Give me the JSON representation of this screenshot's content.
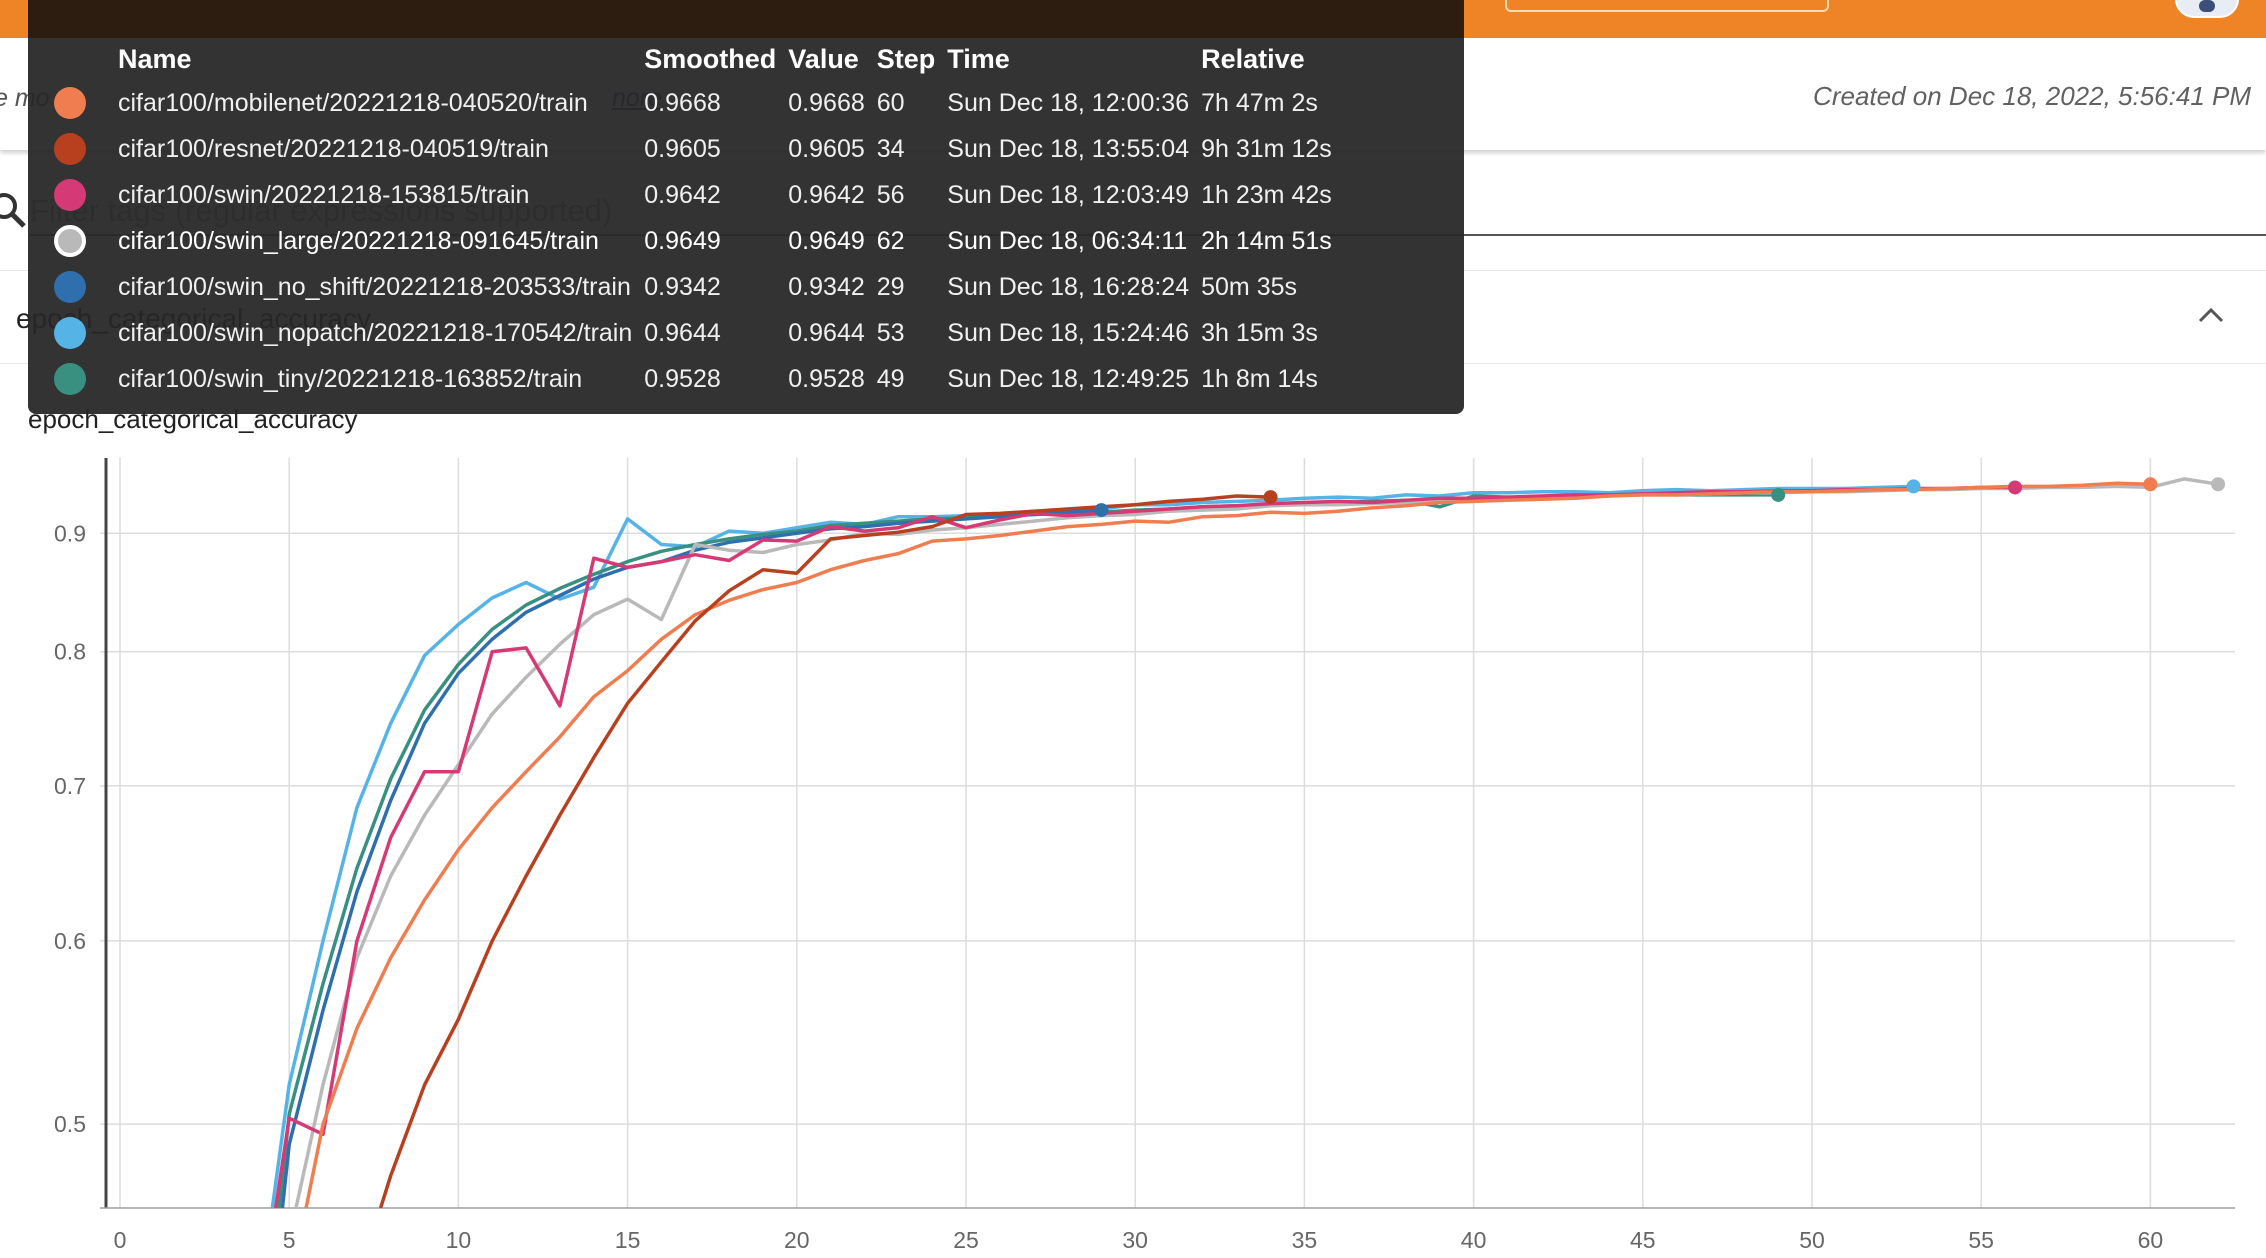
{
  "header": {
    "description_left": "e mo",
    "description_link": "nore",
    "created": "Created on Dec 18, 2022, 5:56:41 PM"
  },
  "filter": {
    "placeholder": "Filter tags (regular expressions supported)"
  },
  "card": {
    "title": "epoch_categorical_accuracy"
  },
  "colors": {
    "mobilenet": "#ef7d4f",
    "resnet": "#b8401f",
    "swin": "#d63a76",
    "swin_large": "#b9b9b9",
    "swin_no_shift": "#2f6fae",
    "swin_nopatch": "#55b3e6",
    "swin_tiny": "#3a9080"
  },
  "tooltip": {
    "columns": [
      "Name",
      "Smoothed",
      "Value",
      "Step",
      "Time",
      "Relative"
    ],
    "rows": [
      {
        "key": "mobilenet",
        "name": "cifar100/mobilenet/20221218-040520/train",
        "smoothed": "0.9668",
        "value": "0.9668",
        "step": "60",
        "time": "Sun Dec 18, 12:00:36",
        "relative": "7h 47m 2s"
      },
      {
        "key": "resnet",
        "name": "cifar100/resnet/20221218-040519/train",
        "smoothed": "0.9605",
        "value": "0.9605",
        "step": "34",
        "time": "Sun Dec 18, 13:55:04",
        "relative": "9h 31m 12s"
      },
      {
        "key": "swin",
        "name": "cifar100/swin/20221218-153815/train",
        "smoothed": "0.9642",
        "value": "0.9642",
        "step": "56",
        "time": "Sun Dec 18, 12:03:49",
        "relative": "1h 23m 42s"
      },
      {
        "key": "swin_large",
        "name": "cifar100/swin_large/20221218-091645/train",
        "smoothed": "0.9649",
        "value": "0.9649",
        "step": "62",
        "time": "Sun Dec 18, 06:34:11",
        "relative": "2h 14m 51s",
        "highlighted": true
      },
      {
        "key": "swin_no_shift",
        "name": "cifar100/swin_no_shift/20221218-203533/train",
        "smoothed": "0.9342",
        "value": "0.9342",
        "step": "29",
        "time": "Sun Dec 18, 16:28:24",
        "relative": "50m 35s"
      },
      {
        "key": "swin_nopatch",
        "name": "cifar100/swin_nopatch/20221218-170542/train",
        "smoothed": "0.9644",
        "value": "0.9644",
        "step": "53",
        "time": "Sun Dec 18, 15:24:46",
        "relative": "3h 15m 3s"
      },
      {
        "key": "swin_tiny",
        "name": "cifar100/swin_tiny/20221218-163852/train",
        "smoothed": "0.9528",
        "value": "0.9528",
        "step": "49",
        "time": "Sun Dec 18, 12:49:25",
        "relative": "1h 8m 14s"
      }
    ]
  },
  "chart_data": {
    "type": "line",
    "title": "epoch_categorical_accuracy",
    "xlim": [
      0,
      62.5
    ],
    "ylim": [
      0.46,
      0.97
    ],
    "y_scale": "log",
    "x_ticks": [
      0,
      5,
      10,
      15,
      20,
      25,
      30,
      35,
      40,
      45,
      50,
      55,
      60
    ],
    "y_ticks": [
      0.5,
      0.6,
      0.7,
      0.8,
      0.9
    ],
    "grid": true,
    "series": [
      {
        "key": "swin_nopatch",
        "x": [
          4.5,
          5,
          6,
          7,
          8,
          9,
          10,
          11,
          12,
          13,
          14,
          15,
          16,
          17,
          18,
          19,
          20,
          21,
          22,
          23,
          24,
          25,
          26,
          27,
          28,
          29,
          30,
          31,
          32,
          33,
          34,
          35,
          36,
          37,
          38,
          39,
          40,
          41,
          42,
          43,
          44,
          45,
          46,
          47,
          48,
          49,
          50,
          51,
          52,
          53
        ],
        "y": [
          0.46,
          0.52,
          0.6,
          0.685,
          0.745,
          0.797,
          0.822,
          0.844,
          0.857,
          0.843,
          0.853,
          0.913,
          0.89,
          0.888,
          0.902,
          0.9,
          0.905,
          0.91,
          0.908,
          0.915,
          0.915,
          0.916,
          0.917,
          0.92,
          0.919,
          0.922,
          0.926,
          0.926,
          0.928,
          0.929,
          0.93,
          0.932,
          0.933,
          0.932,
          0.935,
          0.934,
          0.937,
          0.937,
          0.938,
          0.938,
          0.937,
          0.939,
          0.94,
          0.939,
          0.94,
          0.941,
          0.941,
          0.941,
          0.942,
          0.943
        ]
      },
      {
        "key": "swin_tiny",
        "x": [
          4.7,
          5,
          6,
          7,
          8,
          9,
          10,
          11,
          12,
          13,
          14,
          15,
          16,
          17,
          18,
          19,
          20,
          21,
          22,
          23,
          24,
          25,
          26,
          27,
          28,
          29,
          30,
          31,
          32,
          33,
          34,
          35,
          36,
          37,
          38,
          39,
          40,
          41,
          42,
          43,
          44,
          45,
          46,
          47,
          48,
          49
        ],
        "y": [
          0.46,
          0.505,
          0.575,
          0.645,
          0.705,
          0.755,
          0.79,
          0.818,
          0.838,
          0.852,
          0.864,
          0.875,
          0.884,
          0.89,
          0.895,
          0.899,
          0.902,
          0.907,
          0.909,
          0.911,
          0.913,
          0.914,
          0.916,
          0.917,
          0.918,
          0.919,
          0.921,
          0.922,
          0.924,
          0.925,
          0.926,
          0.927,
          0.928,
          0.929,
          0.93,
          0.924,
          0.934,
          0.933,
          0.932,
          0.934,
          0.935,
          0.936,
          0.935,
          0.935,
          0.935,
          0.935
        ]
      },
      {
        "key": "swin_no_shift",
        "x": [
          4.8,
          5,
          6,
          7,
          8,
          9,
          10,
          11,
          12,
          13,
          14,
          15,
          16,
          17,
          18,
          19,
          20,
          21,
          22,
          23,
          24,
          25,
          26,
          27,
          28,
          29
        ],
        "y": [
          0.46,
          0.49,
          0.56,
          0.63,
          0.69,
          0.745,
          0.783,
          0.81,
          0.832,
          0.846,
          0.86,
          0.87,
          0.875,
          0.885,
          0.892,
          0.896,
          0.9,
          0.904,
          0.906,
          0.909,
          0.911,
          0.913,
          0.915,
          0.917,
          0.919,
          0.921
        ]
      },
      {
        "key": "swin_large",
        "x": [
          5.2,
          6,
          7,
          8,
          9,
          10,
          11,
          12,
          13,
          14,
          15,
          16,
          17,
          18,
          19,
          20,
          21,
          22,
          23,
          24,
          25,
          26,
          27,
          28,
          29,
          30,
          31,
          32,
          33,
          34,
          35,
          36,
          37,
          38,
          39,
          40,
          41,
          42,
          43,
          44,
          45,
          46,
          47,
          48,
          49,
          50,
          51,
          52,
          53,
          54,
          55,
          56,
          57,
          58,
          59,
          60,
          61,
          62
        ],
        "y": [
          0.46,
          0.52,
          0.59,
          0.64,
          0.68,
          0.715,
          0.752,
          0.78,
          0.806,
          0.83,
          0.843,
          0.826,
          0.89,
          0.885,
          0.883,
          0.89,
          0.894,
          0.9,
          0.899,
          0.903,
          0.905,
          0.908,
          0.911,
          0.914,
          0.916,
          0.917,
          0.92,
          0.921,
          0.922,
          0.925,
          0.926,
          0.926,
          0.927,
          0.928,
          0.93,
          0.93,
          0.932,
          0.932,
          0.933,
          0.934,
          0.935,
          0.935,
          0.936,
          0.937,
          0.937,
          0.938,
          0.938,
          0.939,
          0.94,
          0.94,
          0.941,
          0.941,
          0.942,
          0.942,
          0.943,
          0.942,
          0.95,
          0.945
        ]
      },
      {
        "key": "swin",
        "x": [
          4.6,
          5,
          6,
          7,
          8,
          9,
          10,
          11,
          12,
          13,
          14,
          15,
          16,
          17,
          18,
          19,
          20,
          21,
          22,
          23,
          24,
          25,
          26,
          27,
          28,
          29,
          30,
          31,
          32,
          33,
          34,
          35,
          36,
          37,
          38,
          39,
          40,
          41,
          42,
          43,
          44,
          45,
          46,
          47,
          48,
          49,
          50,
          51,
          52,
          53,
          54,
          55,
          56
        ],
        "y": [
          0.46,
          0.503,
          0.495,
          0.6,
          0.665,
          0.71,
          0.71,
          0.8,
          0.803,
          0.758,
          0.878,
          0.87,
          0.875,
          0.881,
          0.876,
          0.894,
          0.893,
          0.906,
          0.902,
          0.905,
          0.915,
          0.905,
          0.912,
          0.918,
          0.916,
          0.918,
          0.92,
          0.922,
          0.924,
          0.925,
          0.927,
          0.928,
          0.929,
          0.928,
          0.93,
          0.932,
          0.932,
          0.933,
          0.934,
          0.935,
          0.935,
          0.936,
          0.937,
          0.938,
          0.938,
          0.939,
          0.939,
          0.94,
          0.94,
          0.941,
          0.941,
          0.942,
          0.942
        ]
      },
      {
        "key": "mobilenet",
        "x": [
          5.5,
          6,
          7,
          8,
          9,
          10,
          11,
          12,
          13,
          14,
          15,
          16,
          17,
          18,
          19,
          20,
          21,
          22,
          23,
          24,
          25,
          26,
          27,
          28,
          29,
          30,
          31,
          32,
          33,
          34,
          35,
          36,
          37,
          38,
          39,
          40,
          41,
          42,
          43,
          44,
          45,
          46,
          47,
          48,
          49,
          50,
          51,
          52,
          53,
          54,
          55,
          56,
          57,
          58,
          59,
          60
        ],
        "y": [
          0.46,
          0.5,
          0.55,
          0.59,
          0.625,
          0.657,
          0.685,
          0.71,
          0.735,
          0.765,
          0.785,
          0.81,
          0.83,
          0.842,
          0.851,
          0.857,
          0.868,
          0.876,
          0.882,
          0.893,
          0.895,
          0.898,
          0.902,
          0.906,
          0.908,
          0.911,
          0.91,
          0.915,
          0.916,
          0.919,
          0.918,
          0.92,
          0.923,
          0.925,
          0.928,
          0.929,
          0.93,
          0.931,
          0.932,
          0.934,
          0.935,
          0.935,
          0.936,
          0.937,
          0.938,
          0.938,
          0.939,
          0.94,
          0.94,
          0.941,
          0.942,
          0.943,
          0.943,
          0.944,
          0.946,
          0.945
        ]
      },
      {
        "key": "resnet",
        "x": [
          7.7,
          8,
          9,
          10,
          11,
          12,
          13,
          14,
          15,
          16,
          17,
          18,
          19,
          20,
          21,
          22,
          23,
          24,
          25,
          26,
          27,
          28,
          29,
          30,
          31,
          32,
          33,
          34
        ],
        "y": [
          0.46,
          0.475,
          0.52,
          0.555,
          0.6,
          0.64,
          0.68,
          0.72,
          0.76,
          0.792,
          0.825,
          0.85,
          0.868,
          0.865,
          0.895,
          0.898,
          0.901,
          0.906,
          0.917,
          0.918,
          0.92,
          0.922,
          0.924,
          0.926,
          0.929,
          0.931,
          0.934,
          0.933
        ]
      }
    ],
    "end_markers": [
      {
        "key": "resnet",
        "x": 34,
        "y": 0.933
      },
      {
        "key": "swin_no_shift",
        "x": 29,
        "y": 0.921
      },
      {
        "key": "swin_tiny",
        "x": 49,
        "y": 0.935
      },
      {
        "key": "swin_nopatch",
        "x": 53,
        "y": 0.943
      },
      {
        "key": "swin",
        "x": 56,
        "y": 0.942
      },
      {
        "key": "mobilenet",
        "x": 60,
        "y": 0.945
      },
      {
        "key": "swin_large",
        "x": 62,
        "y": 0.945
      }
    ]
  }
}
